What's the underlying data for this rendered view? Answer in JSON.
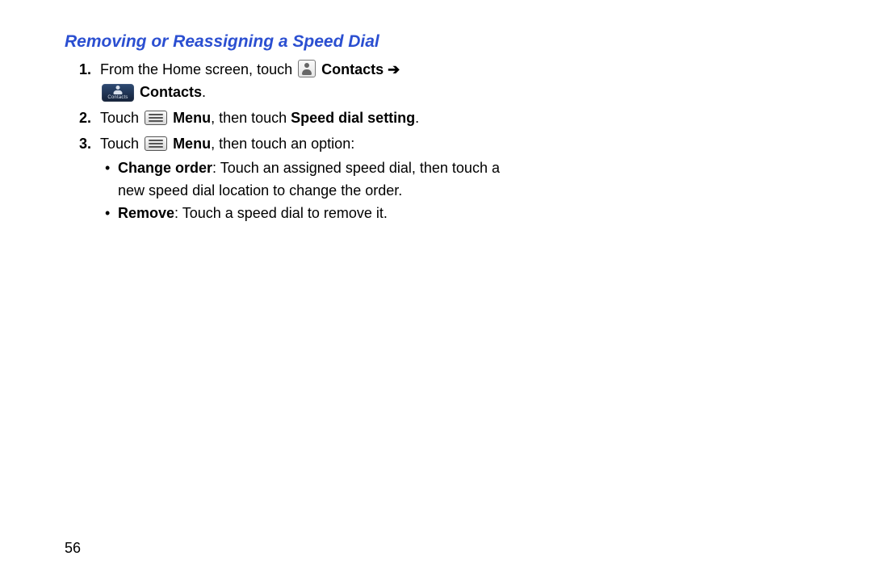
{
  "heading": "Removing or Reassigning a Speed Dial",
  "steps": {
    "s1_num": "1.",
    "s1_a": "From the Home screen, touch ",
    "s1_contacts1": "Contacts",
    "s1_arrow": " ➔ ",
    "s1_contacts2": "Contacts",
    "s1_end": ".",
    "app_label": "Contacts",
    "s2_num": "2.",
    "s2_a": "Touch ",
    "s2_menu": "Menu",
    "s2_b": ", then touch ",
    "s2_speed": "Speed dial setting",
    "s2_end": ".",
    "s3_num": "3.",
    "s3_a": "Touch ",
    "s3_menu": "Menu",
    "s3_b": ", then touch an option:",
    "b1_label": "Change order",
    "b1_text": ": Touch an assigned speed dial, then touch a new speed dial location to change the order.",
    "b2_label": "Remove",
    "b2_text": ": Touch a speed dial to remove it."
  },
  "page_number": "56"
}
